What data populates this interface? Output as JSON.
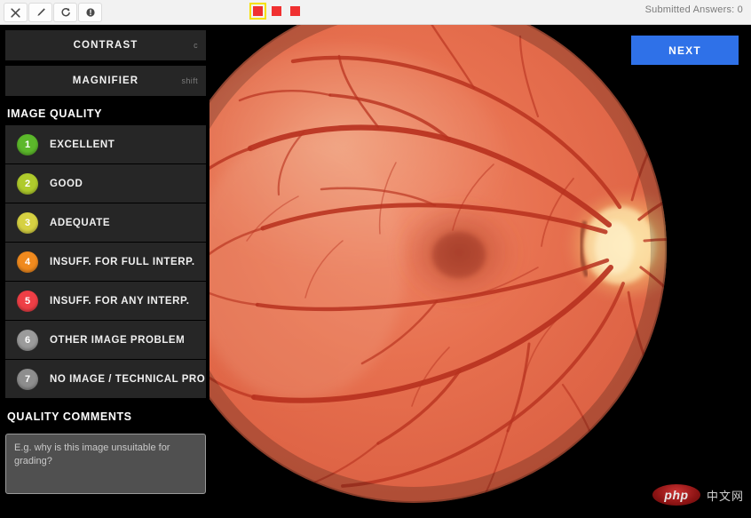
{
  "topbar": {
    "tools": [
      {
        "name": "close-icon",
        "title": "Close"
      },
      {
        "name": "pen-icon",
        "title": "Annotate"
      },
      {
        "name": "refresh-icon",
        "title": "Reset"
      },
      {
        "name": "info-icon",
        "title": "Info"
      }
    ],
    "color_chips": [
      {
        "name": "color-chip-1",
        "color": "#f03030",
        "selected": true
      },
      {
        "name": "color-chip-2",
        "color": "#f03030",
        "selected": false
      },
      {
        "name": "color-chip-3",
        "color": "#f03030",
        "selected": false
      }
    ],
    "submitted_label": "Submitted Answers: 0"
  },
  "sidebar": {
    "modes": [
      {
        "label": "CONTRAST",
        "shortcut": "c"
      },
      {
        "label": "MAGNIFIER",
        "shortcut": "shift"
      }
    ],
    "image_quality": {
      "heading": "IMAGE QUALITY",
      "options": [
        {
          "num": "1",
          "label": "EXCELLENT",
          "color": "#5cb82b"
        },
        {
          "num": "2",
          "label": "GOOD",
          "color": "#afcb2c"
        },
        {
          "num": "3",
          "label": "ADEQUATE",
          "color": "#d6d142"
        },
        {
          "num": "4",
          "label": "INSUFF. FOR FULL INTERP.",
          "color": "#f08a1e"
        },
        {
          "num": "5",
          "label": "INSUFF. FOR ANY INTERP.",
          "color": "#ef3f46"
        },
        {
          "num": "6",
          "label": "OTHER IMAGE PROBLEM",
          "color": "#9b9b9b"
        },
        {
          "num": "7",
          "label": "NO IMAGE / TECHNICAL PROB.",
          "color": "#8e8e8e"
        }
      ]
    },
    "quality_comments": {
      "heading": "QUALITY COMMENTS",
      "placeholder": "E.g. why is this image unsuitable for grading?",
      "value": ""
    }
  },
  "stage": {
    "next_label": "NEXT",
    "image_alt": "retinal-fundus-photograph",
    "watermark": {
      "logo_text": "php",
      "site_text": "中文网"
    }
  },
  "colors": {
    "accent_blue": "#2f71e8",
    "panel": "#262626",
    "background": "#000000",
    "topbar": "#f2f2f2",
    "fundus_base": "#e06a4c"
  }
}
